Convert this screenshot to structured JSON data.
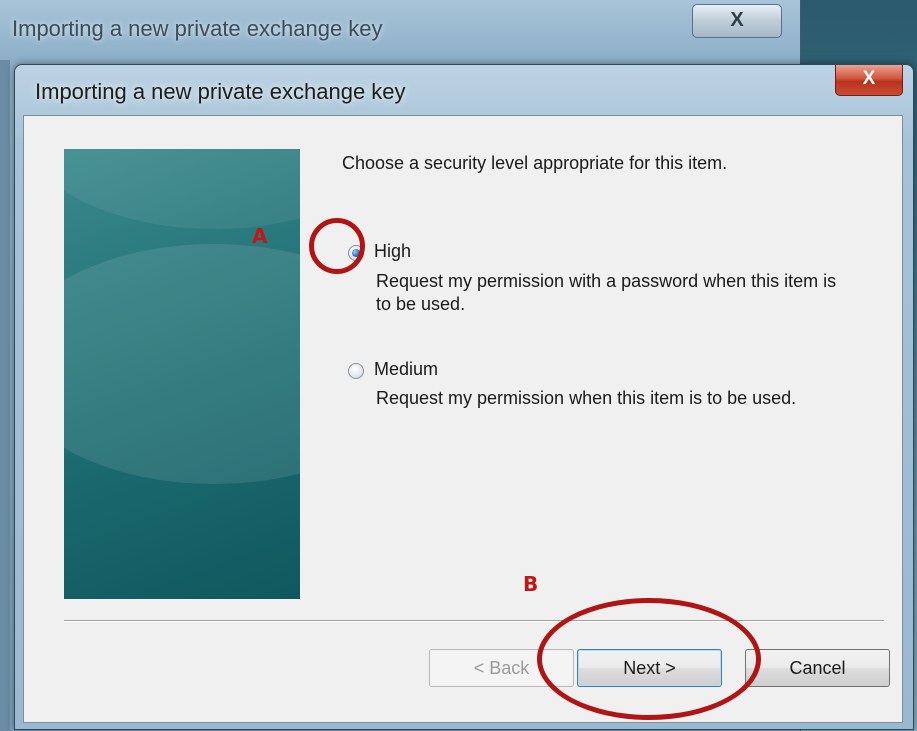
{
  "background_window": {
    "title": "Importing a new private exchange key",
    "close_glyph": "X"
  },
  "dialog": {
    "title": "Importing a new private exchange key",
    "close_glyph": "X",
    "instruction": "Choose a security level appropriate for this item.",
    "options": [
      {
        "label": "High",
        "description": "Request my permission with a password when this item is to be used.",
        "selected": true
      },
      {
        "label": "Medium",
        "description": "Request my permission when this item is to be used.",
        "selected": false
      }
    ],
    "buttons": {
      "back": "< Back",
      "next": "Next >",
      "cancel": "Cancel"
    }
  },
  "annotations": {
    "a": "A",
    "b": "B",
    "color": "#b01515"
  },
  "colors": {
    "side_panel": "#1b6a6f",
    "close_button": "#c94b33",
    "dialog_background": "#f0f0f0"
  }
}
